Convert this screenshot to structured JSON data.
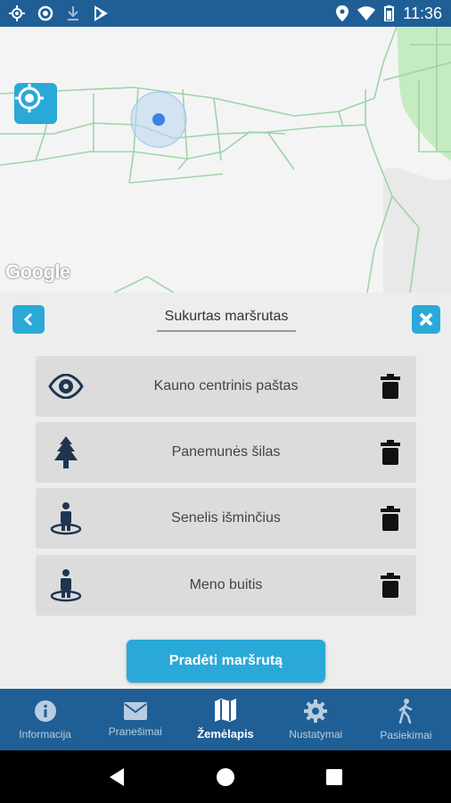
{
  "status_bar": {
    "time": "11:36",
    "icons": [
      "location-icon",
      "circle-notification-icon",
      "download-icon",
      "app-notification-icon",
      "location-pin-icon",
      "wifi-icon",
      "battery-icon"
    ]
  },
  "map": {
    "attribution": "Google",
    "locate_icon": "crosshair-icon"
  },
  "route_panel": {
    "title": "Sukurtas maršrutas",
    "items": [
      {
        "label": "Kauno centrinis paštas",
        "icon": "eye-icon"
      },
      {
        "label": "Panemunės šilas",
        "icon": "tree-icon"
      },
      {
        "label": "Senelis išminčius",
        "icon": "person-pin-icon"
      },
      {
        "label": "Meno buitis",
        "icon": "person-pin-icon"
      }
    ],
    "start_button": "Pradėti maršrutą"
  },
  "bottom_nav": {
    "items": [
      {
        "label": "Informacija",
        "icon": "info-icon"
      },
      {
        "label": "Pranešimai",
        "icon": "mail-icon"
      },
      {
        "label": "Žemėlapis",
        "icon": "map-icon",
        "active": true
      },
      {
        "label": "Nustatymai",
        "icon": "gear-icon"
      },
      {
        "label": "Pasiekimai",
        "icon": "walking-icon"
      }
    ]
  },
  "colors": {
    "primary": "#1f5f96",
    "accent": "#2aa9d8",
    "map_road": "#9fd3a8",
    "park": "#c5ecc0"
  }
}
